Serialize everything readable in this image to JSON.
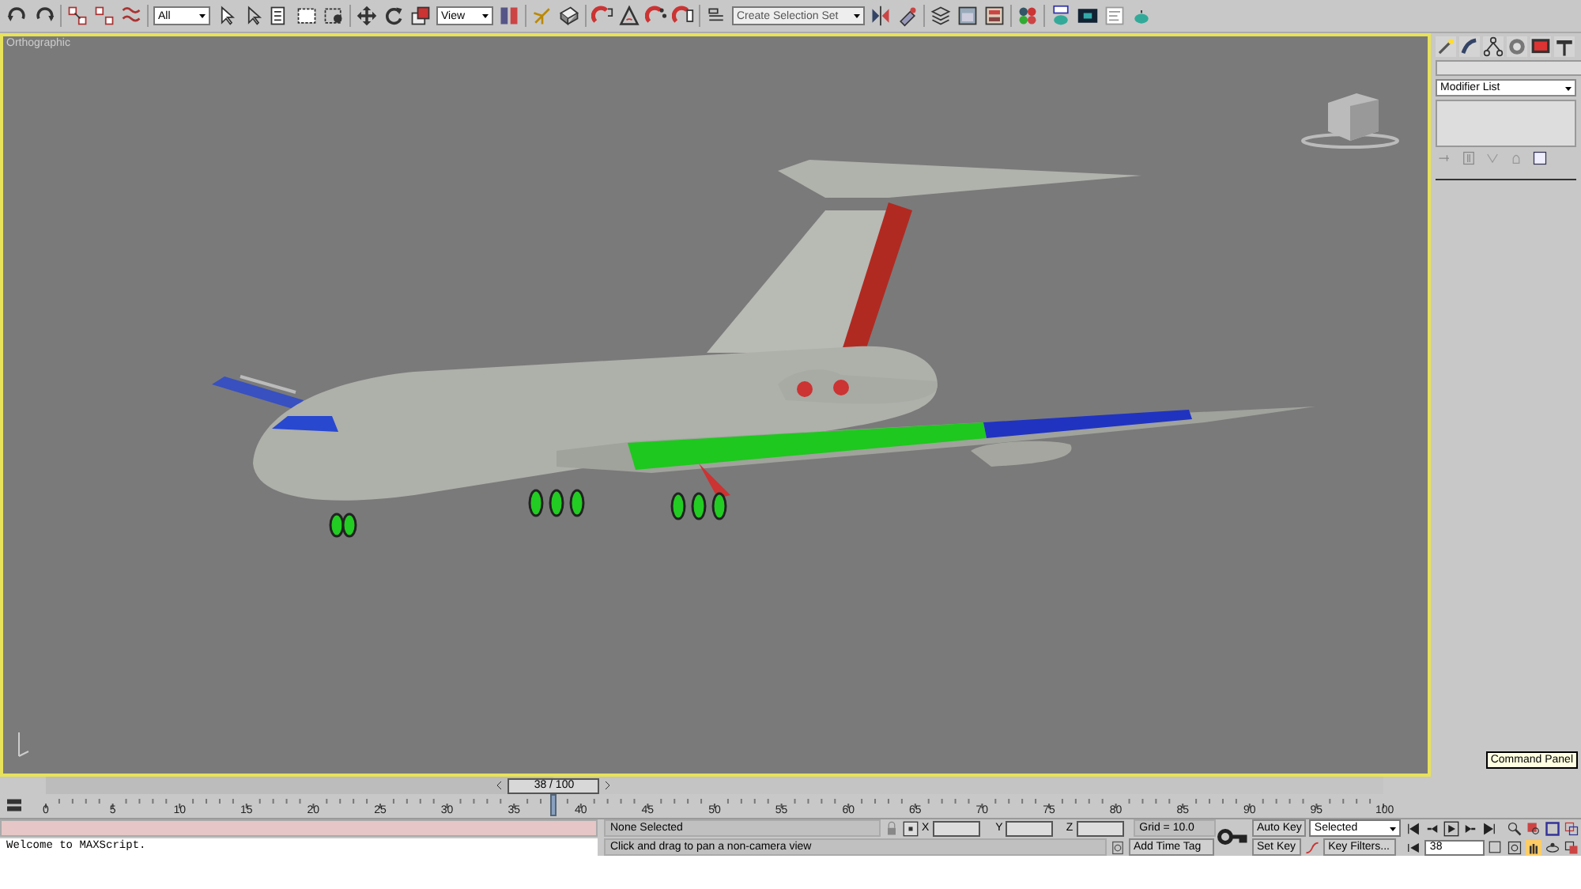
{
  "toolbar": {
    "selection_filter": "All",
    "reference_coordinate": "View",
    "selection_set_placeholder": "Create Selection Set"
  },
  "viewport": {
    "label": "Orthographic",
    "active": true
  },
  "command_panel": {
    "modifier_list": "Modifier List",
    "tooltip": "Command Panel"
  },
  "time_slider": {
    "label": "38 / 100",
    "level": 0.38
  },
  "ruler": {
    "ticks": [
      "0",
      "5",
      "10",
      "15",
      "20",
      "25",
      "30",
      "35",
      "40",
      "45",
      "50",
      "55",
      "60",
      "65",
      "70",
      "75",
      "80",
      "85",
      "90",
      "95",
      "100"
    ]
  },
  "status_bar": {
    "maxscript_output": "Welcome to MAXScript.",
    "selection": "None Selected",
    "prompt": "Click and drag to pan a non-camera view",
    "x_label": "X",
    "y_label": "Y",
    "z_label": "Z",
    "grid": "Grid = 10.0",
    "add_time_tag": "Add Time Tag"
  },
  "animation": {
    "auto_key": "Auto Key",
    "key_mode": "Selected",
    "set_key": "Set Key",
    "key_filters": "Key Filters...",
    "current_frame": "38"
  }
}
